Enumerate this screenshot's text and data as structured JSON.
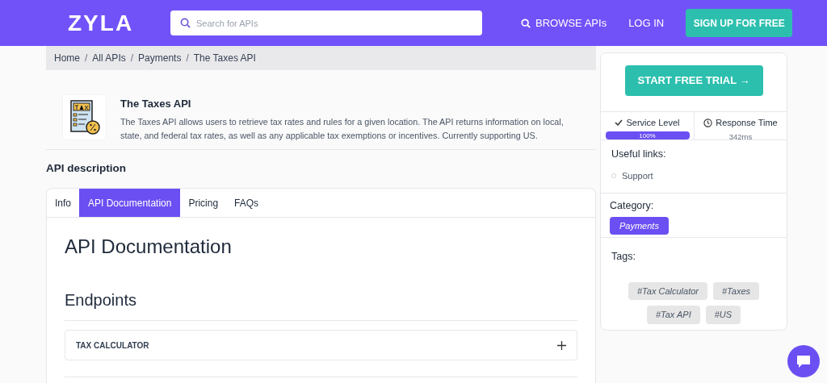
{
  "header": {
    "logo": "ZYLA",
    "search": {
      "placeholder": "Search for APIs"
    },
    "nav": [
      {
        "label": "BROWSE APIs",
        "kind": "search-link"
      },
      {
        "label": "LOG IN",
        "kind": "link"
      },
      {
        "label": "SIGN UP FOR FREE",
        "kind": "button"
      }
    ]
  },
  "breadcrumb": {
    "separator": "/",
    "items": [
      "Home",
      "All APIs",
      "Payments",
      "The Taxes API"
    ]
  },
  "api": {
    "title": "The Taxes API",
    "description": "The Taxes API allows users to retrieve tax rates and rules for a given location. The API returns information on local, state, and federal tax rates, as well as any applicable tax exemptions or incentives. Currently supporting US."
  },
  "section_title": "API description",
  "tabs": [
    {
      "label": "Info",
      "selected": false
    },
    {
      "label": "API Documentation",
      "selected": true
    },
    {
      "label": "Pricing",
      "selected": false
    },
    {
      "label": "FAQs",
      "selected": false
    }
  ],
  "doc": {
    "heading": "API Documentation",
    "subheading": "Endpoints",
    "endpoints": [
      {
        "label": "TAX CALCULATOR",
        "expanded": false
      }
    ]
  },
  "sidebar": {
    "cta": "START FREE TRIAL →",
    "service_level": {
      "label": "Service Level",
      "level": 1,
      "reading": "100%"
    },
    "response_time": {
      "label": "Response Time",
      "value": "342ms"
    },
    "useful_links_title": "Useful links:",
    "links": [
      "Support"
    ],
    "category_title": "Category:",
    "category": "Payments",
    "tags_title": "Tags:",
    "tags": [
      "#Tax Calculator",
      "#Taxes",
      "#Tax API",
      "#US"
    ]
  }
}
